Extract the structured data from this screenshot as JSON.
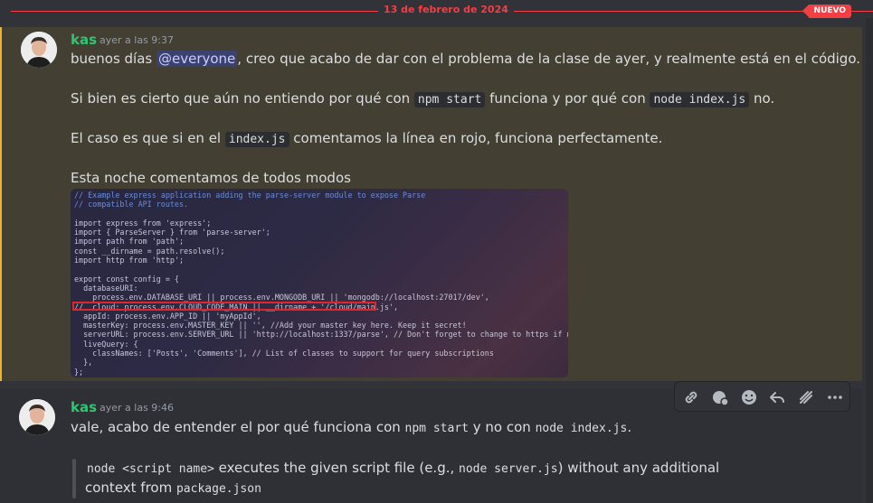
{
  "divider": {
    "date": "13 de febrero de 2024",
    "badge": "NUEVO"
  },
  "message1": {
    "author": "kas",
    "time": "ayer a las 9:37",
    "line1_pre": "buenos días ",
    "mention": "@everyone",
    "line1_post": ", creo que acabo de dar con el problema de la clase de ayer, y realmente está en el código.",
    "line2_pre": "Si bien es cierto que aún no entiendo por qué con ",
    "line2_code1": "npm start",
    "line2_mid": " funciona y por qué con ",
    "line2_code2": "node index.js",
    "line2_post": " no.",
    "line3_pre": "El caso es que si en el ",
    "line3_code": "index.js",
    "line3_post": " comentamos la línea en rojo, funciona perfectamente.",
    "line4": "Esta noche comentamos de todos modos"
  },
  "attachment_code": [
    "// Example express application adding the parse-server module to expose Parse",
    "// compatible API routes.",
    "",
    "import express from 'express';",
    "import { ParseServer } from 'parse-server';",
    "import path from 'path';",
    "const __dirname = path.resolve();",
    "import http from 'http';",
    "",
    "export const config = {",
    "  databaseURI:",
    "    process.env.DATABASE_URI || process.env.MONGODB_URI || 'mongodb://localhost:27017/dev',",
    "//  cloud: process.env.CLOUD_CODE_MAIN || __dirname + '/cloud/main.js',",
    "  appId: process.env.APP_ID || 'myAppId',",
    "  masterKey: process.env.MASTER_KEY || '', //Add your master key here. Keep it secret!",
    "  serverURL: process.env.SERVER_URL || 'http://localhost:1337/parse', // Don't forget to change to https if needed",
    "  liveQuery: {",
    "    classNames: ['Posts', 'Comments'], // List of classes to support for query subscriptions",
    "  },",
    "};"
  ],
  "message2": {
    "author": "kas",
    "time": "ayer a las 9:46",
    "line1_pre": "vale, acabo de entender el por qué funciona con ",
    "line1_code1": "npm start",
    "line1_mid": " y no con ",
    "line1_code2": "node index.js",
    "line1_post": ".",
    "quote_code1": "node <script name>",
    "quote_text1": " executes the given script file (e.g., ",
    "quote_code2": "node server.js",
    "quote_text2": ") without any additional",
    "quote_text3": "context from ",
    "quote_code3": "package.json"
  },
  "toolbar": {
    "icons": [
      "link-icon",
      "thread-icon",
      "emoji-icon",
      "reply-icon",
      "forward-icon",
      "more-icon"
    ]
  }
}
